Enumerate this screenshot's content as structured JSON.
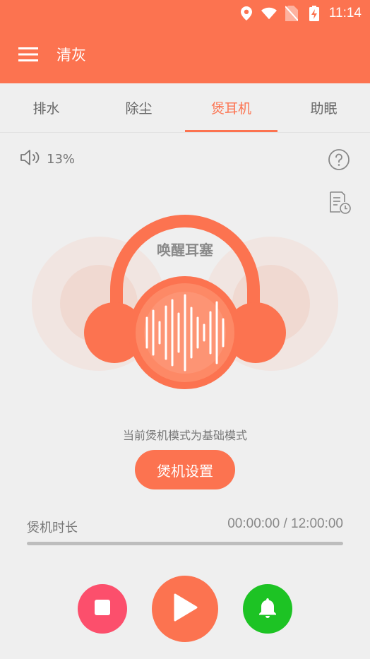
{
  "status_bar": {
    "time": "11:14",
    "icons": [
      "location-icon",
      "wifi-icon",
      "no-sim-icon",
      "battery-charging-icon"
    ]
  },
  "app_bar": {
    "menu_icon": "hamburger-menu-icon",
    "title": "清灰"
  },
  "tabs": [
    {
      "label": "排水",
      "active": false
    },
    {
      "label": "除尘",
      "active": false
    },
    {
      "label": "煲耳机",
      "active": true
    },
    {
      "label": "助眠",
      "active": false
    }
  ],
  "volume": {
    "icon": "speaker-icon",
    "value_text": "13%"
  },
  "help_icon": "help-circle-icon",
  "schedule_icon": "schedule-list-icon",
  "visual": {
    "label": "唤醒耳塞",
    "icon": "headphones-waveform-icon"
  },
  "mode_text": "当前煲机模式为基础模式",
  "settings_button": "煲机设置",
  "duration": {
    "label": "煲机时长",
    "time_text": "00:00:00 / 12:00:00",
    "progress": 0
  },
  "controls": {
    "stop_icon": "stop-icon",
    "play_icon": "play-icon",
    "alarm_icon": "bell-icon"
  },
  "colors": {
    "accent": "#fc7350",
    "stop": "#fc4f6c",
    "alarm": "#1dc324",
    "background": "#efefef"
  }
}
